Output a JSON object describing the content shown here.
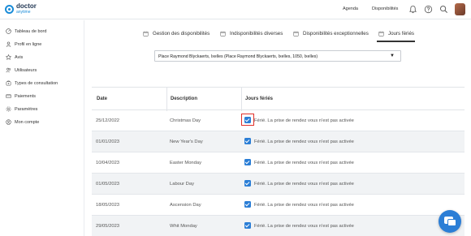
{
  "brand": {
    "name": "doctor",
    "sub": "anytime",
    "color": "#1a8cd8"
  },
  "topnav": {
    "agenda": "Agenda",
    "disponibilites": "Disponibilités"
  },
  "sidebar": {
    "items": [
      {
        "label": "Tableau de bord",
        "icon": "dashboard-icon"
      },
      {
        "label": "Profil en ligne",
        "icon": "profile-icon"
      },
      {
        "label": "Avis",
        "icon": "star-icon"
      },
      {
        "label": "Utilisateurs",
        "icon": "users-icon"
      },
      {
        "label": "Types de consultation",
        "icon": "consultation-icon"
      },
      {
        "label": "Paiements",
        "icon": "wallet-icon"
      },
      {
        "label": "Paramètres",
        "icon": "gear-icon"
      },
      {
        "label": "Mon compte",
        "icon": "account-icon"
      }
    ]
  },
  "tabs": [
    {
      "label": "Gestion des disponibilités"
    },
    {
      "label": "Indisponibilités diverses"
    },
    {
      "label": "Disponibilités exceptionnelles"
    },
    {
      "label": "Jours fériés",
      "active": true
    }
  ],
  "location": {
    "selected": "Place Raymond Blyckaerts, Ixelles (Place Raymond Blyckaerts, Ixelles, 1050, Ixelles)",
    "caret": "▼"
  },
  "table": {
    "headers": {
      "date": "Date",
      "description": "Description",
      "holidays": "Jours fériés"
    },
    "checkbox_text": "Férié. La prise de rendez vous n'est pas activée",
    "rows": [
      {
        "date": "25/12/2022",
        "description": "Christmas Day",
        "checked": true
      },
      {
        "date": "01/01/2023",
        "description": "New Year's Day",
        "checked": true
      },
      {
        "date": "10/04/2023",
        "description": "Easter Monday",
        "checked": true
      },
      {
        "date": "01/05/2023",
        "description": "Labour Day",
        "checked": true
      },
      {
        "date": "18/05/2023",
        "description": "Ascension Day",
        "checked": true
      },
      {
        "date": "29/05/2023",
        "description": "Whit Monday",
        "checked": true
      }
    ]
  },
  "colors": {
    "accent": "#2b7ed6",
    "highlight": "#e0302a"
  }
}
